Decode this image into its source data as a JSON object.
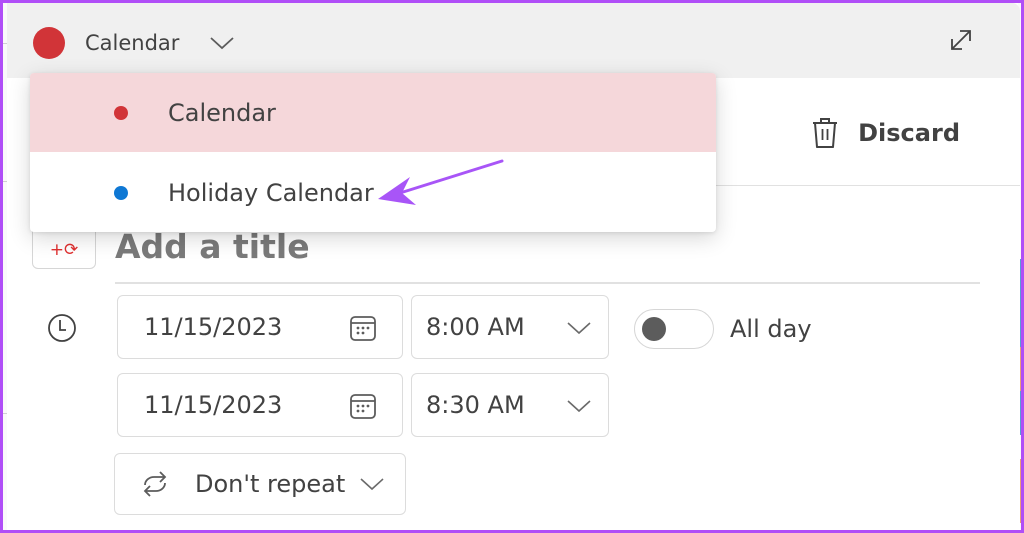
{
  "header": {
    "selected_calendar": "Calendar",
    "selected_calendar_color": "#d13438",
    "expand_icon": "expand-diagonal-icon"
  },
  "calendar_dropdown": {
    "items": [
      {
        "label": "Calendar",
        "color": "#d13438",
        "selected": true
      },
      {
        "label": "Holiday Calendar",
        "color": "#0f78d4",
        "selected": false
      }
    ]
  },
  "toolbar": {
    "discard_label": "Discard",
    "discard_icon": "trash-icon"
  },
  "event": {
    "title_placeholder": "Add a title",
    "title_value": "",
    "emoji_button_icon": "emoji-plus-icon",
    "start_date": "11/15/2023",
    "start_time": "8:00 AM",
    "end_date": "11/15/2023",
    "end_time": "8:30 AM",
    "all_day_label": "All day",
    "all_day_on": false,
    "repeat_value": "Don't repeat"
  },
  "annotation": {
    "arrow_color": "#a855f7",
    "points_to": "Holiday Calendar"
  },
  "colors": {
    "frame": "#b04ef7",
    "header_bg": "#f0f0f0",
    "selected_bg": "#f5d7da"
  }
}
